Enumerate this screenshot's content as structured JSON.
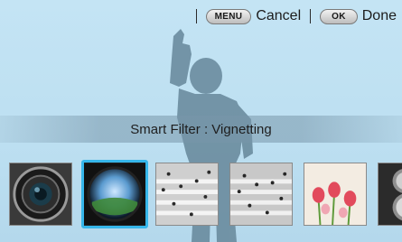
{
  "topbar": {
    "menu_key": "MENU",
    "cancel_label": "Cancel",
    "ok_key": "OK",
    "done_label": "Done"
  },
  "filter": {
    "name": "Smart Filter : Vignetting"
  },
  "filters": [
    {
      "icon": "lens-icon",
      "selected": false
    },
    {
      "icon": "vignetting-icon",
      "selected": true
    },
    {
      "icon": "crosswalk-icon",
      "selected": false
    },
    {
      "icon": "crosswalk-icon",
      "selected": false
    },
    {
      "icon": "flowers-icon",
      "selected": false
    },
    {
      "icon": "clock-icon",
      "selected": false
    }
  ],
  "colors": {
    "background": "#bfe0f1",
    "selection": "#36b6ea",
    "silhouette": "#5f7f91"
  }
}
